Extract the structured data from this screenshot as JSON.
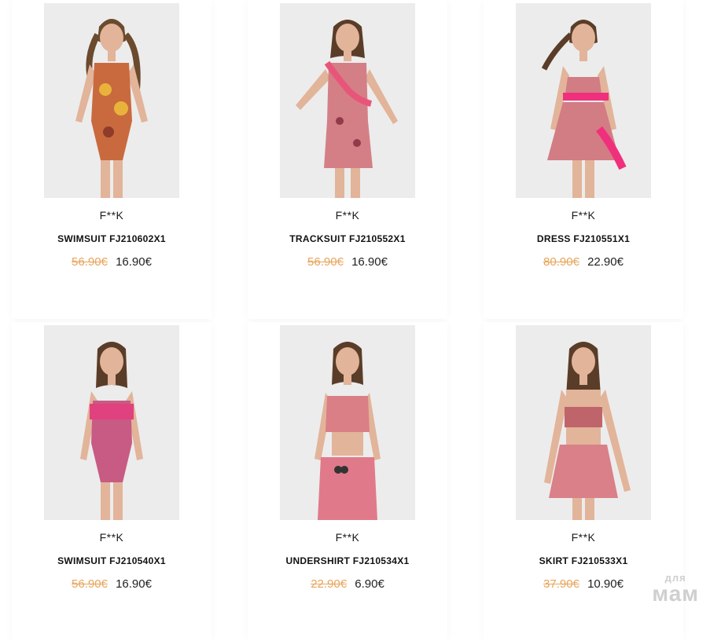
{
  "products": [
    {
      "brand": "F**K",
      "title": "SWIMSUIT FJ210602X1",
      "old_price": "56.90€",
      "price": "16.90€",
      "garment": "swimsuit",
      "colors": {
        "main": "#c96a3e",
        "accent": "#e9b33b"
      }
    },
    {
      "brand": "F**K",
      "title": "TRACKSUIT FJ210552X1",
      "old_price": "56.90€",
      "price": "16.90€",
      "garment": "tracksuit",
      "colors": {
        "main": "#d47f86",
        "accent": "#e8557a"
      }
    },
    {
      "brand": "F**K",
      "title": "DRESS FJ210551X1",
      "old_price": "80.90€",
      "price": "22.90€",
      "garment": "dress",
      "colors": {
        "main": "#d27c84",
        "accent": "#f0307d"
      }
    },
    {
      "brand": "F**K",
      "title": "SWIMSUIT FJ210540X1",
      "old_price": "56.90€",
      "price": "16.90€",
      "garment": "swimsuit-ruffle",
      "colors": {
        "main": "#c85b83",
        "accent": "#e0417f"
      }
    },
    {
      "brand": "F**K",
      "title": "UNDERSHIRT FJ210534X1",
      "old_price": "22.90€",
      "price": "6.90€",
      "garment": "top-shorts",
      "colors": {
        "main": "#da7f86",
        "accent": "#e07a8a"
      }
    },
    {
      "brand": "F**K",
      "title": "SKIRT FJ210533X1",
      "old_price": "37.90€",
      "price": "10.90€",
      "garment": "bandeau-skirt",
      "colors": {
        "main": "#d98088",
        "accent": "#c0646b"
      }
    }
  ],
  "watermark": {
    "top": "для",
    "bottom": "мам"
  },
  "colors": {
    "old_price": "#e8a45a",
    "text": "#111111",
    "photo_bg": "#e9e9e9"
  }
}
